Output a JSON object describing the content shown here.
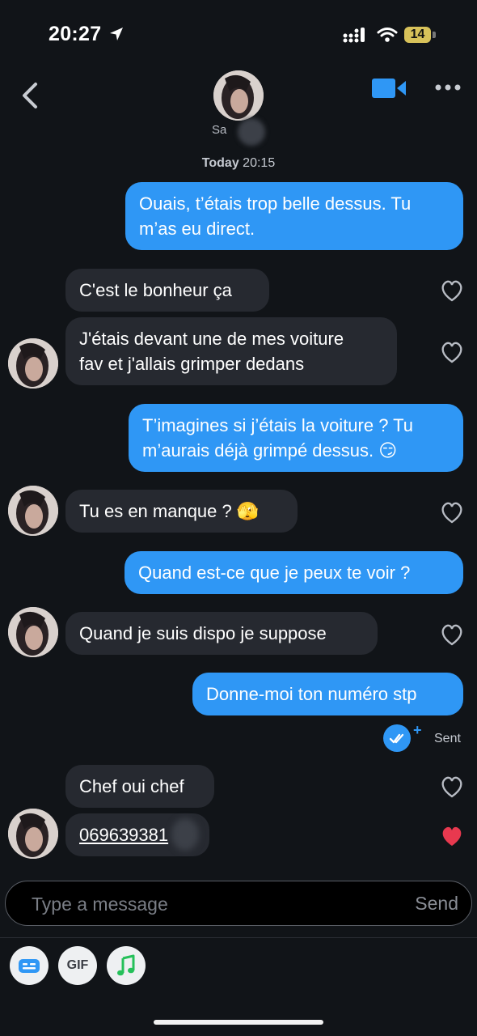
{
  "status_bar": {
    "time": "20:27",
    "battery": "14"
  },
  "header": {
    "contact_name": "Sa",
    "back_icon": "chevron-left-icon",
    "video_icon": "video-camera-icon",
    "more_icon": "more-dots-icon"
  },
  "date_label": {
    "day": "Today",
    "time": "20:15"
  },
  "messages": [
    {
      "dir": "out",
      "lines": [
        "Ouais, t’étais trop belle dessus. Tu",
        "m’as eu direct."
      ]
    },
    {
      "dir": "in",
      "lines": [
        "C'est le bonheur ça"
      ]
    },
    {
      "dir": "in",
      "lines": [
        "J'étais devant une de mes voiture",
        "fav et j'allais grimper dedans"
      ]
    },
    {
      "dir": "out",
      "lines": [
        "T’imagines si j’étais la voiture ? Tu",
        "m’aurais déjà grimpé dessus. 😏"
      ]
    },
    {
      "dir": "in",
      "lines": [
        "Tu es en manque ? 🫣"
      ]
    },
    {
      "dir": "out",
      "lines": [
        "Quand est-ce que je peux te voir ?"
      ]
    },
    {
      "dir": "in",
      "lines": [
        "Quand je suis dispo je suppose"
      ]
    },
    {
      "dir": "out",
      "lines": [
        "Donne-moi ton numéro stp"
      ]
    },
    {
      "dir": "in",
      "lines": [
        "Chef oui chef"
      ]
    },
    {
      "dir": "in",
      "lines": [
        "069639381"
      ],
      "liked": true
    }
  ],
  "sent_status": "Sent",
  "composer": {
    "placeholder": "Type a message",
    "send_label": "Send"
  },
  "toolbar": {
    "gif_label": "GIF"
  },
  "colors": {
    "background": "#111418",
    "outgoing": "#2f97f5",
    "incoming": "#262930",
    "heart_liked": "#e8394f"
  }
}
